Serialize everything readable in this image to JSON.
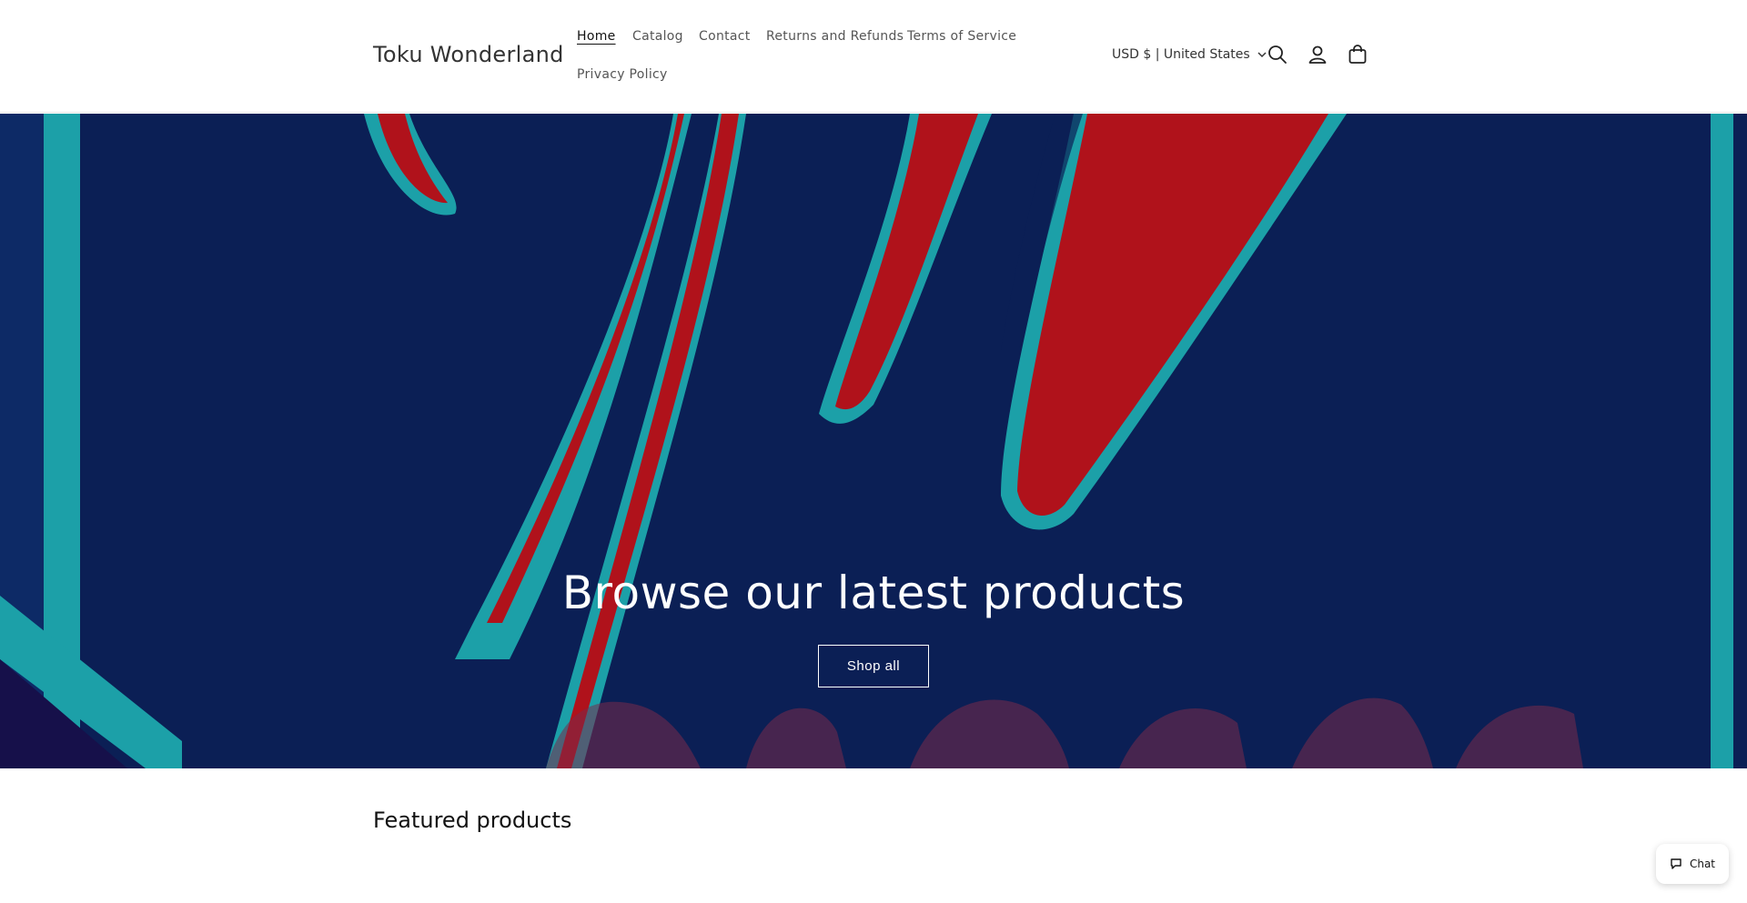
{
  "store": {
    "name": "Toku Wonderland"
  },
  "nav": {
    "items": [
      {
        "label": "Home",
        "active": true
      },
      {
        "label": "Catalog"
      },
      {
        "label": "Contact"
      },
      {
        "label": "Returns and Refunds"
      },
      {
        "label": "Terms of Service"
      },
      {
        "label": "Privacy Policy"
      }
    ]
  },
  "header": {
    "currency": "USD $ | United States",
    "icons": [
      "search-icon",
      "account-icon",
      "cart-icon",
      "chevron-down-icon"
    ]
  },
  "hero": {
    "title": "Browse our latest products",
    "button_label": "Shop all",
    "background_text": "Toku Wonderland",
    "colors": {
      "background": "#0b1f55",
      "accent_red": "#c4131c",
      "accent_teal": "#1ca0a8"
    }
  },
  "featured": {
    "title": "Featured products"
  },
  "chat": {
    "label": "Chat",
    "icon": "chat-bubble-icon"
  }
}
